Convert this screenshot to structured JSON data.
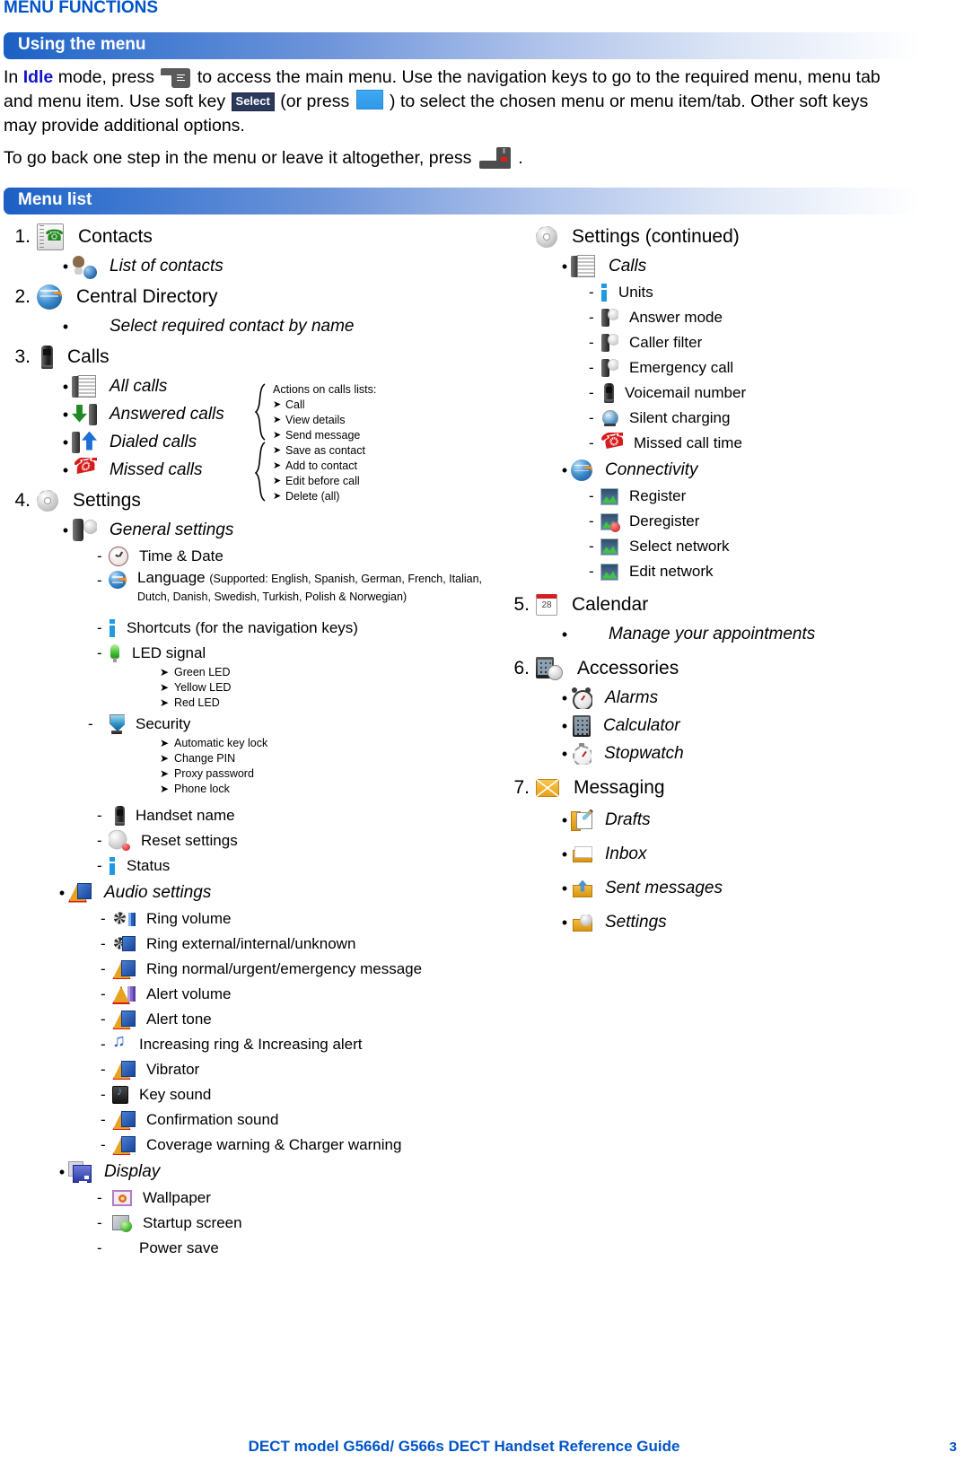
{
  "document": {
    "chapter_title": "MENU FUNCTIONS",
    "footer_title": "DECT model G566d/ G566s DECT Handset Reference Guide",
    "page_number": "3"
  },
  "section_using_menu": {
    "heading": "Using the menu",
    "para1_a": "In ",
    "para1_idle": "Idle",
    "para1_b": " mode, press ",
    "para1_c": " to access the main menu. Use the navigation keys to go to the required menu, menu tab and menu item. Use soft key ",
    "para1_select": "Select",
    "para1_d": " (or press ",
    "para1_e": " ) to select the chosen menu or menu item/tab. Other soft keys may provide additional options.",
    "para2_a": "To go back one step in the menu or leave it altogether, press ",
    "para2_b": " ."
  },
  "section_menu_list": {
    "heading": "Menu list"
  },
  "actions_box": {
    "title": "Actions on calls lists:",
    "items": [
      "Call",
      "View details",
      "Send message",
      "Save as contact",
      "Add to contact",
      "Edit before call",
      "Delete (all)"
    ]
  },
  "left_column": [
    {
      "number": "1.",
      "label": "Contacts",
      "icon": "contacts-book-icon",
      "children": [
        {
          "label": "List of contacts",
          "icon": "person-globe-icon"
        }
      ]
    },
    {
      "number": "2.",
      "label": "Central Directory",
      "icon": "globe-icon",
      "children": [
        {
          "label": "Select required contact by name",
          "icon": "none"
        }
      ]
    },
    {
      "number": "3.",
      "label": "Calls",
      "icon": "handset-icon",
      "children": [
        {
          "label": "All calls",
          "icon": "call-list-icon"
        },
        {
          "label": "Answered calls",
          "icon": "answered-call-icon"
        },
        {
          "label": "Dialed calls",
          "icon": "dialed-call-icon"
        },
        {
          "label": "Missed calls",
          "icon": "missed-call-icon"
        }
      ]
    },
    {
      "number": "4.",
      "label": "Settings",
      "icon": "gear-icon",
      "children": [
        {
          "label": "General settings",
          "icon": "general-settings-icon",
          "items": [
            {
              "label": "Time & Date",
              "icon": "clock-icon"
            },
            {
              "label": "Language",
              "icon": "globe-icon",
              "note": "(Supported: English, Spanish, German, French, Italian, Dutch, Danish, Swedish, Turkish, Polish & Norwegian)"
            },
            {
              "label": "Shortcuts (for the navigation keys)",
              "icon": "info-icon"
            },
            {
              "label": "LED signal",
              "icon": "led-icon",
              "sub": [
                "Green LED",
                "Yellow LED",
                "Red LED"
              ]
            },
            {
              "label": "Security",
              "icon": "shield-icon",
              "sub": [
                "Automatic key lock",
                "Change PIN",
                "Proxy password",
                "Phone lock"
              ]
            },
            {
              "label": "Handset name",
              "icon": "handset-icon"
            },
            {
              "label": "Reset settings",
              "icon": "reset-gear-icon"
            },
            {
              "label": "Status",
              "icon": "info-icon"
            }
          ]
        },
        {
          "label": "Audio settings",
          "icon": "audio-settings-icon",
          "items": [
            {
              "label": "Ring volume",
              "icon": "ring-volume-icon"
            },
            {
              "label": "Ring external/internal/unknown",
              "icon": "ring-source-icon"
            },
            {
              "label": "Ring normal/urgent/emergency message",
              "icon": "ring-message-icon"
            },
            {
              "label": "Alert volume",
              "icon": "alert-volume-icon"
            },
            {
              "label": "Alert tone",
              "icon": "alert-tone-icon"
            },
            {
              "label": "Increasing ring & Increasing alert",
              "icon": "music-note-icon"
            },
            {
              "label": "Vibrator",
              "icon": "vibrator-icon"
            },
            {
              "label": "Key sound",
              "icon": "key-sound-icon"
            },
            {
              "label": "Confirmation sound",
              "icon": "confirmation-sound-icon"
            },
            {
              "label": "Coverage warning & Charger warning",
              "icon": "coverage-warning-icon"
            }
          ]
        },
        {
          "label": "Display",
          "icon": "display-icon",
          "items": [
            {
              "label": "Wallpaper",
              "icon": "wallpaper-icon"
            },
            {
              "label": "Startup screen",
              "icon": "startup-screen-icon"
            },
            {
              "label": "Power save",
              "icon": "power-save-icon"
            }
          ]
        }
      ]
    }
  ],
  "right_column": [
    {
      "number": "",
      "label": "Settings (continued)",
      "icon": "gear-icon",
      "children": [
        {
          "label": "Calls",
          "icon": "call-list-icon",
          "items": [
            {
              "label": "Units",
              "icon": "info-icon"
            },
            {
              "label": "Answer mode",
              "icon": "handset-gear-icon"
            },
            {
              "label": "Caller filter",
              "icon": "handset-gear-icon"
            },
            {
              "label": "Emergency call",
              "icon": "handset-gear-icon"
            },
            {
              "label": "Voicemail number",
              "icon": "handset-icon"
            },
            {
              "label": "Silent charging",
              "icon": "silent-charging-icon"
            },
            {
              "label": "Missed call time",
              "icon": "missed-call-icon"
            }
          ]
        },
        {
          "label": "Connectivity",
          "icon": "globe-icon",
          "items": [
            {
              "label": "Register",
              "icon": "network-icon"
            },
            {
              "label": "Deregister",
              "icon": "network-deregister-icon"
            },
            {
              "label": "Select network",
              "icon": "network-icon"
            },
            {
              "label": "Edit network",
              "icon": "network-icon"
            }
          ]
        }
      ]
    },
    {
      "number": "5.",
      "label": "Calendar",
      "icon": "calendar-icon",
      "children": [
        {
          "label": "Manage your appointments",
          "icon": "none"
        }
      ]
    },
    {
      "number": "6.",
      "label": "Accessories",
      "icon": "accessories-icon",
      "children": [
        {
          "label": "Alarms",
          "icon": "alarm-clock-icon"
        },
        {
          "label": "Calculator",
          "icon": "calculator-icon"
        },
        {
          "label": "Stopwatch",
          "icon": "stopwatch-icon"
        }
      ]
    },
    {
      "number": "7.",
      "label": "Messaging",
      "icon": "envelope-icon",
      "children": [
        {
          "label": "Drafts",
          "icon": "drafts-icon"
        },
        {
          "label": "Inbox",
          "icon": "inbox-icon"
        },
        {
          "label": "Sent messages",
          "icon": "sent-messages-icon"
        },
        {
          "label": "Settings",
          "icon": "message-settings-icon"
        }
      ]
    }
  ],
  "colors": {
    "heading_blue": "#0054C8",
    "bar_blue": "#1b5fc4",
    "idle_blue": "#1414C8"
  }
}
